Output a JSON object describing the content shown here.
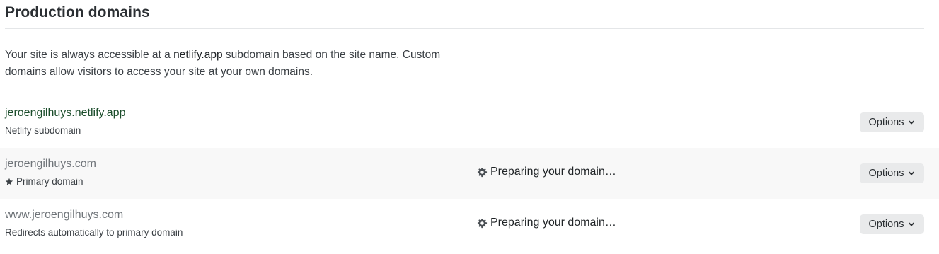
{
  "section": {
    "title": "Production domains"
  },
  "description": {
    "part1": "Your site is always accessible at a ",
    "highlight": "netlify.app",
    "part2": " subdomain based on the site name. Custom domains allow visitors to access your site at your own domains."
  },
  "domains": [
    {
      "name": "jeroengilhuys.netlify.app",
      "subtitle": "Netlify subdomain",
      "status": "",
      "options_label": "Options"
    },
    {
      "name": "jeroengilhuys.com",
      "subtitle": "Primary domain",
      "status": "Preparing your domain…",
      "options_label": "Options"
    },
    {
      "name": "www.jeroengilhuys.com",
      "subtitle": "Redirects automatically to primary domain",
      "status": "Preparing your domain…",
      "options_label": "Options"
    }
  ],
  "icons": {
    "status": "gear-icon",
    "primary": "star-icon",
    "dropdown": "chevron-down-icon"
  },
  "colors": {
    "live_domain": "#1b4d2b",
    "pending_domain": "#6f7479",
    "button_bg": "#e9eaeb",
    "shaded_row": "#f8f8f8"
  }
}
